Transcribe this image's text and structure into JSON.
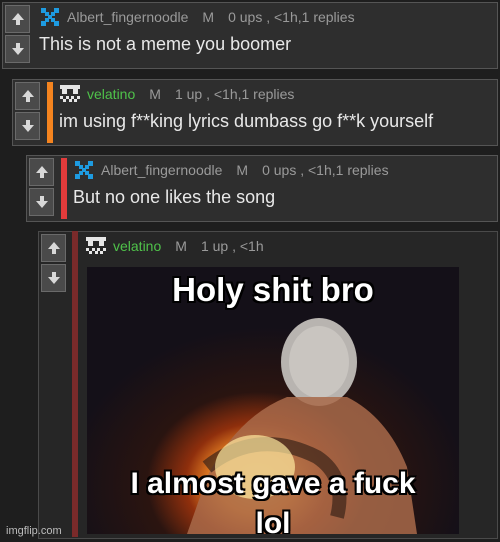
{
  "comments": [
    {
      "username": "Albert_fingernoodle",
      "flag": "M",
      "stats": "0 ups , <1h,1 replies",
      "text": "This is not a meme you boomer"
    },
    {
      "username": "velatino",
      "flag": "M",
      "stats": "1 up , <1h,1 replies",
      "text": "im using f**king lyrics dumbass go f**k yourself",
      "accent_color": "#f5841f"
    },
    {
      "username": "Albert_fingernoodle",
      "flag": "M",
      "stats": "0 ups , <1h,1 replies",
      "text": "But no one likes the song",
      "accent_color": "#e23b3b"
    },
    {
      "username": "velatino",
      "flag": "M",
      "stats": "1 up , <1h",
      "meme": {
        "top_text": "Holy shit bro",
        "bottom_text": "I almost gave a fuck",
        "bottom_text_2": "lol"
      }
    }
  ],
  "watermark": "imgflip.com",
  "colors": {
    "username_gray": "#9a9a9a",
    "username_green": "#4fc24a",
    "avatar_blue": "#1e9be0"
  }
}
